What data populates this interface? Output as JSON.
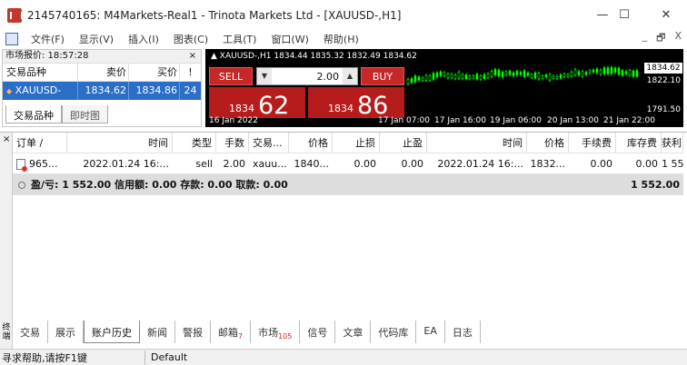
{
  "window": {
    "title": "2145740165: M4Markets-Real1 - Trinota Markets Ltd - [XAUUSD-,H1]",
    "controls": [
      "—",
      "☐",
      "✕"
    ]
  },
  "menu": {
    "items": [
      "文件(F)",
      "显示(V)",
      "插入(I)",
      "图表(C)",
      "工具(T)",
      "窗口(W)",
      "帮助(H)"
    ],
    "right_controls": [
      "_",
      "🗗",
      "X"
    ]
  },
  "market_watch": {
    "title": "市场报价: 18:57:28",
    "close": "×",
    "headers": {
      "symbol": "交易品种",
      "bid": "卖价",
      "ask": "买价",
      "spread": "!"
    },
    "rows": [
      {
        "symbol": "XAUUSD-",
        "bid": "1834.62",
        "ask": "1834.86",
        "spread": "24"
      }
    ],
    "tabs": [
      "交易品种",
      "即时图"
    ]
  },
  "chart": {
    "header": "▲ XAUUSD-,H1  1834.44 1835.32 1832.49 1834.62",
    "sell_label": "SELL",
    "buy_label": "BUY",
    "lot": "2.00",
    "sell_price_small": "1834",
    "sell_price_big": "62",
    "buy_price_small": "1834",
    "buy_price_big": "86",
    "price_labels": [
      "1834.62",
      "1822.10",
      "1791.50"
    ],
    "time_labels": [
      "16 Jan 2022",
      "17 Jan 07:00",
      "17 Jan 16:00",
      "19 Jan 06:00",
      "20 Jan 13:00",
      "21 Jan 22:00"
    ],
    "colors": {
      "bullish": "#00ff00",
      "bearish": "#00ff00",
      "background": "#000000"
    }
  },
  "terminal": {
    "side_label": "终端",
    "close": "×",
    "headers": [
      "订单 /",
      "时间",
      "类型",
      "手数",
      "交易...",
      "价格",
      "止损",
      "止盈",
      "时间",
      "价格",
      "手续费",
      "库存费",
      "获利"
    ],
    "rows": [
      [
        "965...",
        "2022.01.24 16:...",
        "sell",
        "2.00",
        "xauu...",
        "1840...",
        "0.00",
        "0.00",
        "2022.01.24 16:...",
        "1832...",
        "0.00",
        "0.00",
        "1 552.00"
      ]
    ],
    "summary": "盈/亏: 1 552.00  信用额: 0.00  存款: 0.00  取款: 0.00",
    "summary_total": "1 552.00"
  },
  "tabs": [
    {
      "label": "交易",
      "badge": ""
    },
    {
      "label": "展示",
      "badge": ""
    },
    {
      "label": "账户历史",
      "badge": ""
    },
    {
      "label": "新闻",
      "badge": ""
    },
    {
      "label": "警报",
      "badge": ""
    },
    {
      "label": "邮箱",
      "badge": "7"
    },
    {
      "label": "市场",
      "badge": "105"
    },
    {
      "label": "信号",
      "badge": ""
    },
    {
      "label": "文章",
      "badge": ""
    },
    {
      "label": "代码库",
      "badge": ""
    },
    {
      "label": "EA",
      "badge": ""
    },
    {
      "label": "日志",
      "badge": ""
    }
  ],
  "status": {
    "help": "寻求帮助,请按F1键",
    "profile": "Default"
  }
}
